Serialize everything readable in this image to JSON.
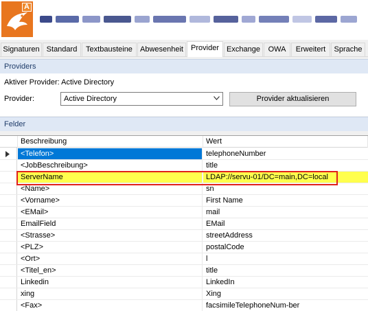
{
  "header": {
    "logo_letter": "A"
  },
  "tabs": [
    {
      "label": "Signaturen",
      "active": false
    },
    {
      "label": "Standard",
      "active": false
    },
    {
      "label": "Textbausteine",
      "active": false
    },
    {
      "label": "Abwesenheit",
      "active": false
    },
    {
      "label": "Provider",
      "active": true
    },
    {
      "label": "Exchange",
      "active": false
    },
    {
      "label": "OWA",
      "active": false
    },
    {
      "label": "Erweitert",
      "active": false
    },
    {
      "label": "Sprache",
      "active": false
    }
  ],
  "providers": {
    "section_title": "Providers",
    "active_provider_text": "Aktiver Provider: Active Directory",
    "provider_label": "Provider:",
    "provider_value": "Active Directory",
    "update_button": "Provider aktualisieren"
  },
  "felder": {
    "section_title": "Felder",
    "columns": [
      "Beschreibung",
      "Wert"
    ],
    "rows": [
      {
        "beschreibung": "<Telefon>",
        "wert": "telephoneNumber",
        "selected": true
      },
      {
        "beschreibung": "<JobBeschreibung>",
        "wert": "title"
      },
      {
        "beschreibung": "ServerName",
        "wert": "LDAP://servu-01/DC=main,DC=local",
        "highlighted": true
      },
      {
        "beschreibung": "<Name>",
        "wert": "sn"
      },
      {
        "beschreibung": "<Vorname>",
        "wert": "First Name"
      },
      {
        "beschreibung": "<EMail>",
        "wert": "mail"
      },
      {
        "beschreibung": "EmailField",
        "wert": "EMail"
      },
      {
        "beschreibung": "<Strasse>",
        "wert": "streetAddress"
      },
      {
        "beschreibung": "<PLZ>",
        "wert": "postalCode"
      },
      {
        "beschreibung": "<Ort>",
        "wert": "l"
      },
      {
        "beschreibung": "<Titel_en>",
        "wert": "title"
      },
      {
        "beschreibung": "Linkedin",
        "wert": "LinkedIn"
      },
      {
        "beschreibung": "xing",
        "wert": "Xing"
      },
      {
        "beschreibung": "<Fax>",
        "wert": "facsimileTelephoneNum-ber"
      }
    ]
  },
  "colors": {
    "selection": "#0078d7",
    "highlight": "#ffff4d",
    "highlight_border": "#e0201a",
    "section_header": "#dfe8f5",
    "logo": "#e8761f"
  }
}
